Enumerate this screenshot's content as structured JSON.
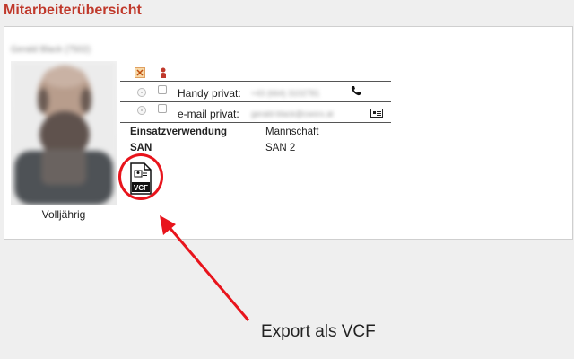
{
  "page": {
    "title": "Mitarbeiterübersicht"
  },
  "person": {
    "name": "Gerald Black (7502)",
    "age_status": "Volljährig"
  },
  "header_icons": [
    "delete-icon",
    "person-icon"
  ],
  "contacts": [
    {
      "label": "Handy privat:",
      "value": "+43 (664) 3102781",
      "icon": "phone-icon"
    },
    {
      "label": "e-mail privat:",
      "value": "gerald-black@cworx.at",
      "icon": "mail-card-icon"
    }
  ],
  "info": [
    {
      "key": "Einsatzverwendung",
      "value": "Mannschaft"
    },
    {
      "key": "SAN",
      "value": "SAN 2"
    }
  ],
  "export": {
    "icon_label": "VCF"
  },
  "annotation": {
    "text": "Export als VCF",
    "color": "#e8141c"
  },
  "colors": {
    "title": "#c0392b",
    "highlight": "#e8141c"
  }
}
